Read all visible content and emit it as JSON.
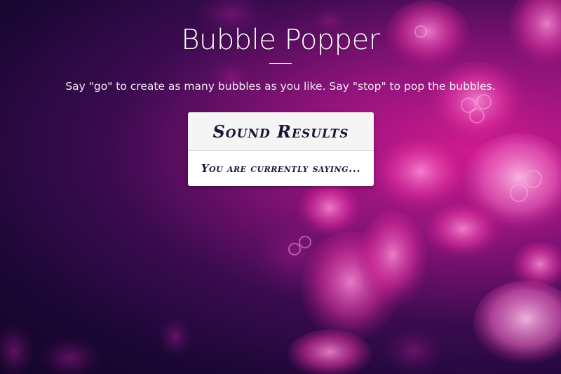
{
  "page": {
    "title": "Bubble Popper",
    "instructions": "Say \"go\" to create as many bubbles as you like. Say \"stop\" to pop the bubbles."
  },
  "results_card": {
    "header": "Sound Results",
    "status_text": "You are currently saying..."
  },
  "colors": {
    "background_dark": "#1b0735",
    "background_magenta": "#d21b8f",
    "card_header_bg": "#f5f5f5",
    "card_text": "#1f1433"
  },
  "background": {
    "image": "jellyfish-background"
  }
}
